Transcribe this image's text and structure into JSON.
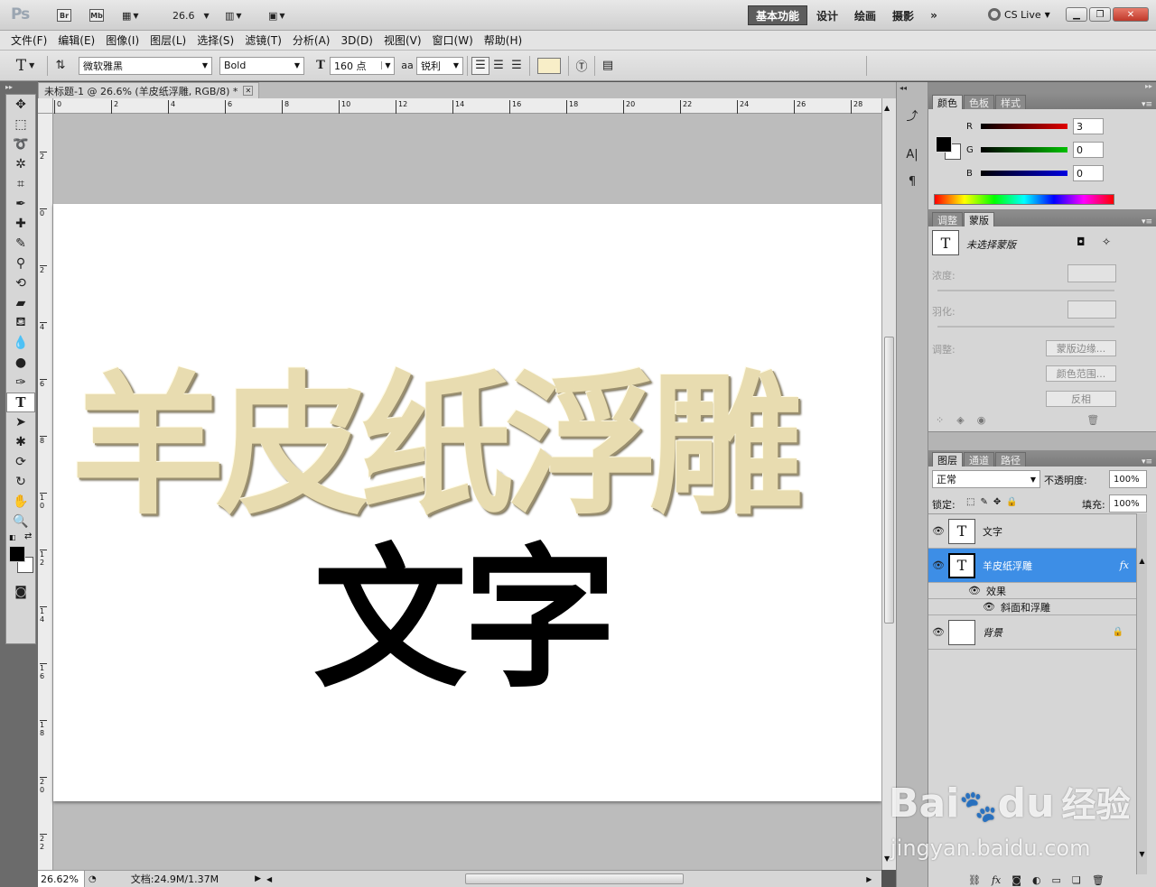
{
  "titlebar": {
    "app_logo": "Ps",
    "bridge_label": "Br",
    "mini_bridge_label": "Mb",
    "zoom_value": "26.6",
    "workspaces": [
      "基本功能",
      "设计",
      "绘画",
      "摄影"
    ],
    "more": "»",
    "cs_live": "CS Live"
  },
  "menu": [
    "文件(F)",
    "编辑(E)",
    "图像(I)",
    "图层(L)",
    "选择(S)",
    "滤镜(T)",
    "分析(A)",
    "3D(D)",
    "视图(V)",
    "窗口(W)",
    "帮助(H)"
  ],
  "options": {
    "font_family": "微软雅黑",
    "font_style": "Bold",
    "font_size": "160 点",
    "antialias_glyph": "aa",
    "antialias": "锐利"
  },
  "document": {
    "tab_title": "未标题-1 @ 26.6% (羊皮纸浮雕, RGB/8) *",
    "ruler_h": [
      "0",
      "2",
      "4",
      "6",
      "8",
      "10",
      "12",
      "14",
      "16",
      "18",
      "20",
      "22",
      "24",
      "26",
      "28"
    ],
    "ruler_v": [
      "2",
      "0",
      "2",
      "4",
      "6",
      "8",
      "1 0",
      "1 2",
      "1 4",
      "1 6",
      "1 8",
      "2 0",
      "2 2"
    ],
    "emboss_text": "羊皮纸浮雕",
    "plain_text": "文字"
  },
  "status": {
    "zoom": "26.62%",
    "doc_size": "文档:24.9M/1.37M"
  },
  "color_panel": {
    "tabs": [
      "颜色",
      "色板",
      "样式"
    ],
    "channels": [
      {
        "label": "R",
        "value": "3",
        "color": "#e00000"
      },
      {
        "label": "G",
        "value": "0",
        "color": "#00c000"
      },
      {
        "label": "B",
        "value": "0",
        "color": "#0000e0"
      }
    ]
  },
  "masks_panel": {
    "tabs": [
      "调整",
      "蒙版"
    ],
    "title": "未选择蒙版",
    "density_label": "浓度:",
    "feather_label": "羽化:",
    "refine_label": "调整:",
    "btn_edge": "蒙版边缘...",
    "btn_range": "颜色范围...",
    "btn_invert": "反相"
  },
  "layers_panel": {
    "tabs": [
      "图层",
      "通道",
      "路径"
    ],
    "blend_mode": "正常",
    "opacity_label": "不透明度:",
    "opacity": "100%",
    "lock_label": "锁定:",
    "fill_label": "填充:",
    "fill": "100%",
    "layers": [
      {
        "name": "文字",
        "thumb": "T"
      },
      {
        "name": "羊皮纸浮雕",
        "thumb": "T",
        "fx": "fx"
      },
      {
        "name": "背景",
        "thumb": ""
      }
    ],
    "effects_label": "效果",
    "effect_item": "斜面和浮雕"
  },
  "watermark": {
    "brand": "Bai",
    "brand2": "du",
    "brand3": "经验",
    "url": "jingyan.baidu.com"
  },
  "colors": {
    "accent": "#3d8ee6",
    "parchment": "#e8dcb0"
  }
}
